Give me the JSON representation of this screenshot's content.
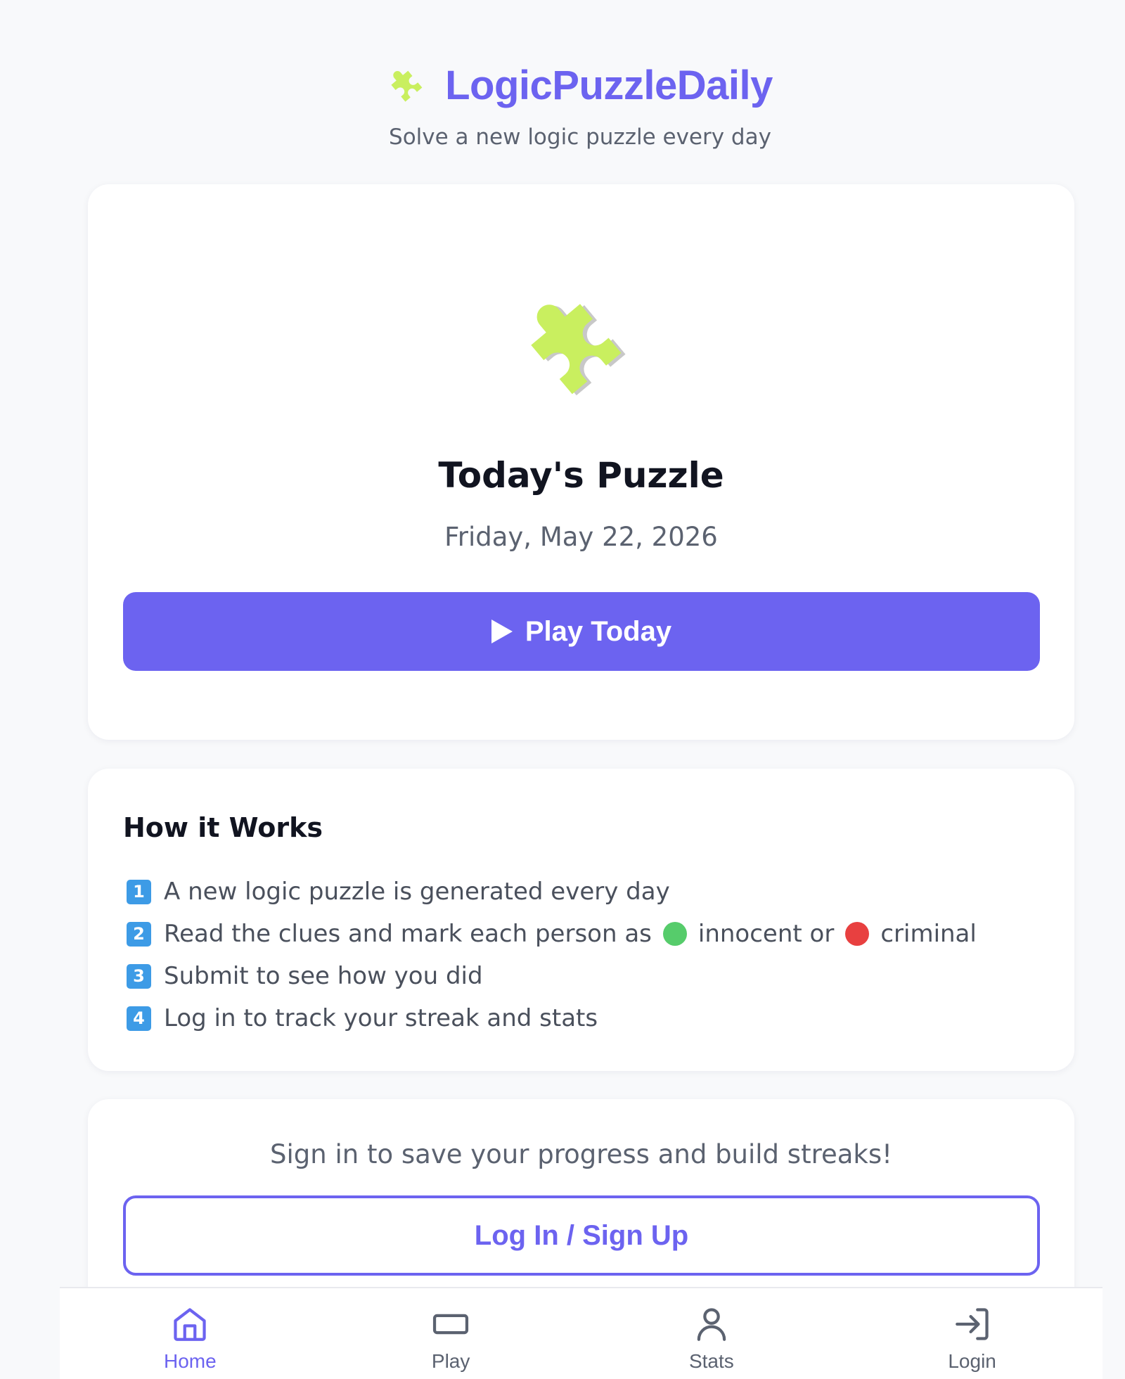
{
  "brand": {
    "title": "LogicPuzzleDaily",
    "subtitle": "Solve a new logic puzzle every day",
    "icon": "puzzle-piece-icon",
    "accent_color": "#6c63f0",
    "puzzle_color": "#c9ef5f"
  },
  "hero": {
    "title": "Today's Puzzle",
    "date": "Friday, May 22, 2026",
    "play_label": "Play Today"
  },
  "how": {
    "title": "How it Works",
    "steps": [
      {
        "num": "1",
        "text": "A new logic puzzle is generated every day"
      },
      {
        "num": "2",
        "text_a": "Read the clues and mark each person as",
        "text_b": "innocent or",
        "text_c": "criminal"
      },
      {
        "num": "3",
        "text": "Submit to see how you did"
      },
      {
        "num": "4",
        "text": "Log in to track your streak and stats"
      }
    ],
    "innocent_color": "#56cc6b",
    "criminal_color": "#e84040"
  },
  "login": {
    "prompt": "Sign in to save your progress and build streaks!",
    "button_label": "Log In / Sign Up"
  },
  "nav": {
    "items": [
      {
        "label": "Home",
        "icon": "home-icon",
        "active": true
      },
      {
        "label": "Play",
        "icon": "play-icon",
        "active": false
      },
      {
        "label": "Stats",
        "icon": "user-icon",
        "active": false
      },
      {
        "label": "Login",
        "icon": "login-icon",
        "active": false
      }
    ]
  }
}
